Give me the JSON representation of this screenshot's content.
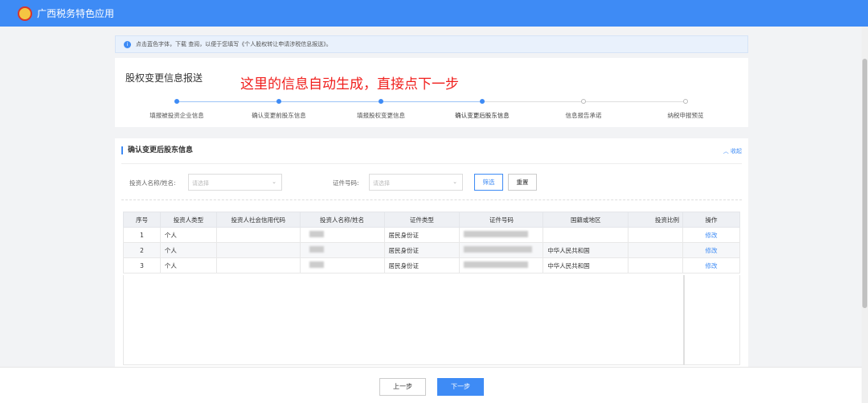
{
  "header": {
    "title": "广西税务特色应用"
  },
  "notice": "点击蓝色字体，下载 查阅，以便于您填写《个人股权转让申请涉税信息报送》。",
  "page_title": "股权变更信息报送",
  "annotation": "这里的信息自动生成，直接点下一步",
  "steps": [
    {
      "label": "填报被投资企业信息",
      "done": true
    },
    {
      "label": "确认变更前股东信息",
      "done": true
    },
    {
      "label": "填报股权变更信息",
      "done": true
    },
    {
      "label": "确认变更后股东信息",
      "done": true
    },
    {
      "label": "信息报告承诺",
      "done": false
    },
    {
      "label": "纳税申报预览",
      "done": false
    }
  ],
  "section": {
    "title": "确认变更后股东信息",
    "collapse": "收起"
  },
  "filters": {
    "name_label": "投资人名称/姓名:",
    "name_placeholder": "请选择",
    "id_label": "证件号码:",
    "id_placeholder": "请选择",
    "filter_btn": "筛选",
    "reset_btn": "重置"
  },
  "table": {
    "headers": [
      "序号",
      "投资人类型",
      "投资人社会信用代码",
      "投资人名称/姓名",
      "证件类型",
      "证件号码",
      "国籍或地区",
      "投资比例",
      "操作"
    ],
    "rows": [
      {
        "no": "1",
        "type": "个人",
        "credit": "",
        "doc_type": "居民身份证",
        "country": "",
        "ratio": "",
        "action": "修改"
      },
      {
        "no": "2",
        "type": "个人",
        "credit": "",
        "doc_type": "居民身份证",
        "country": "中华人民共和国",
        "ratio": "",
        "action": "修改"
      },
      {
        "no": "3",
        "type": "个人",
        "credit": "",
        "doc_type": "居民身份证",
        "country": "中华人民共和国",
        "ratio": "",
        "action": "修改"
      }
    ]
  },
  "footer": {
    "prev": "上一步",
    "next": "下一步"
  },
  "colors": {
    "primary": "#3e8bf5",
    "annotation": "#f0201e"
  }
}
